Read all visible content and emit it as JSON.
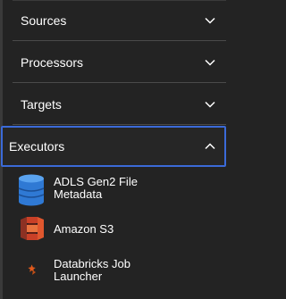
{
  "sections": [
    {
      "label": "Sources",
      "expanded": false
    },
    {
      "label": "Processors",
      "expanded": false
    },
    {
      "label": "Targets",
      "expanded": false
    },
    {
      "label": "Executors",
      "expanded": true
    }
  ],
  "executors": [
    {
      "line1": "ADLS Gen2 File",
      "line2": "Metadata",
      "icon": "adls-database-icon"
    },
    {
      "line1": "Amazon S3",
      "line2": "",
      "icon": "amazon-s3-icon"
    },
    {
      "line1": "Databricks Job",
      "line2": "Launcher",
      "icon": "databricks-spark-icon"
    }
  ],
  "colors": {
    "background": "#232323",
    "focus_border": "#3b6ad8",
    "divider": "#4a4a4a",
    "adls_blue": "#2f79d4",
    "s3_orange": "#e0572e",
    "spark_orange": "#e25a1c"
  }
}
